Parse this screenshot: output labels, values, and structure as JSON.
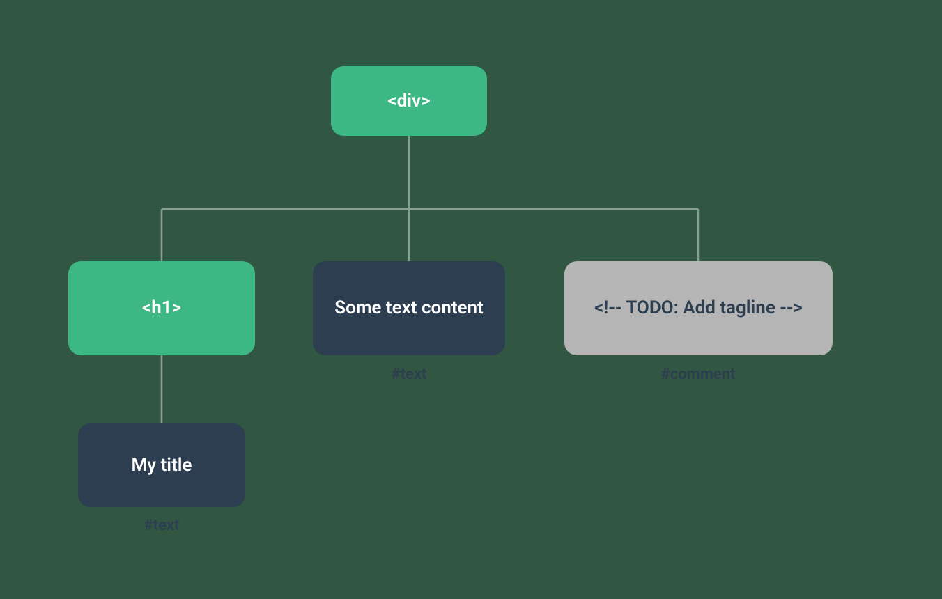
{
  "colors": {
    "green": "#3db783",
    "navy": "#2c3e50",
    "grey": "#b5b5b5",
    "bg": "#315642",
    "connector": "#8aa08f"
  },
  "nodes": {
    "root": {
      "label": "<div>"
    },
    "h1": {
      "label": "<h1>"
    },
    "text_content": {
      "label": "Some text content",
      "caption": "#text"
    },
    "comment": {
      "label": "<!-- TODO: Add tagline  -->",
      "caption": "#comment"
    },
    "h1_text": {
      "label": "My title",
      "caption": "#text"
    }
  }
}
